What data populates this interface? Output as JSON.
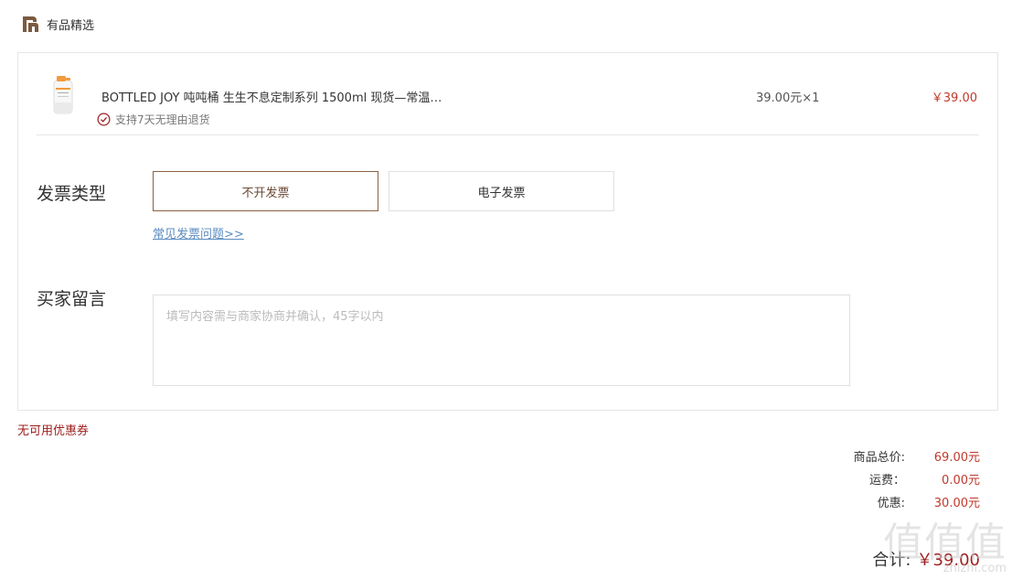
{
  "header": {
    "store_name": "有品精选",
    "logo_icon": "youpin-logo-icon"
  },
  "product": {
    "title": "BOTTLED JOY 吨吨桶 生生不息定制系列 1500ml 现货—常温…",
    "return_policy": "支持7天无理由退货",
    "unit_price_qty": "39.00元×1",
    "row_total": "￥39.00",
    "thumb_icon": "water-bottle-thumbnail"
  },
  "invoice": {
    "label": "发票类型",
    "options": [
      {
        "label": "不开发票",
        "selected": true
      },
      {
        "label": "电子发票",
        "selected": false
      }
    ],
    "faq_link": "常见发票问题>>"
  },
  "message": {
    "label": "买家留言",
    "placeholder": "填写内容需与商家协商并确认，45字以内",
    "value": ""
  },
  "coupon_note": "无可用优惠券",
  "summary": {
    "rows": [
      {
        "label": "商品总价:",
        "value": "69.00元"
      },
      {
        "label": "运费：",
        "value": "0.00元"
      },
      {
        "label": "优惠:",
        "value": "30.00元"
      }
    ],
    "total_label": "合计:",
    "total_value": "￥39.00"
  },
  "watermark": {
    "glyphs": "值值值",
    "url": "zhizhi.com"
  },
  "colors": {
    "accent": "#8a6244",
    "price": "#c0392b",
    "link": "#5b8cc0"
  }
}
